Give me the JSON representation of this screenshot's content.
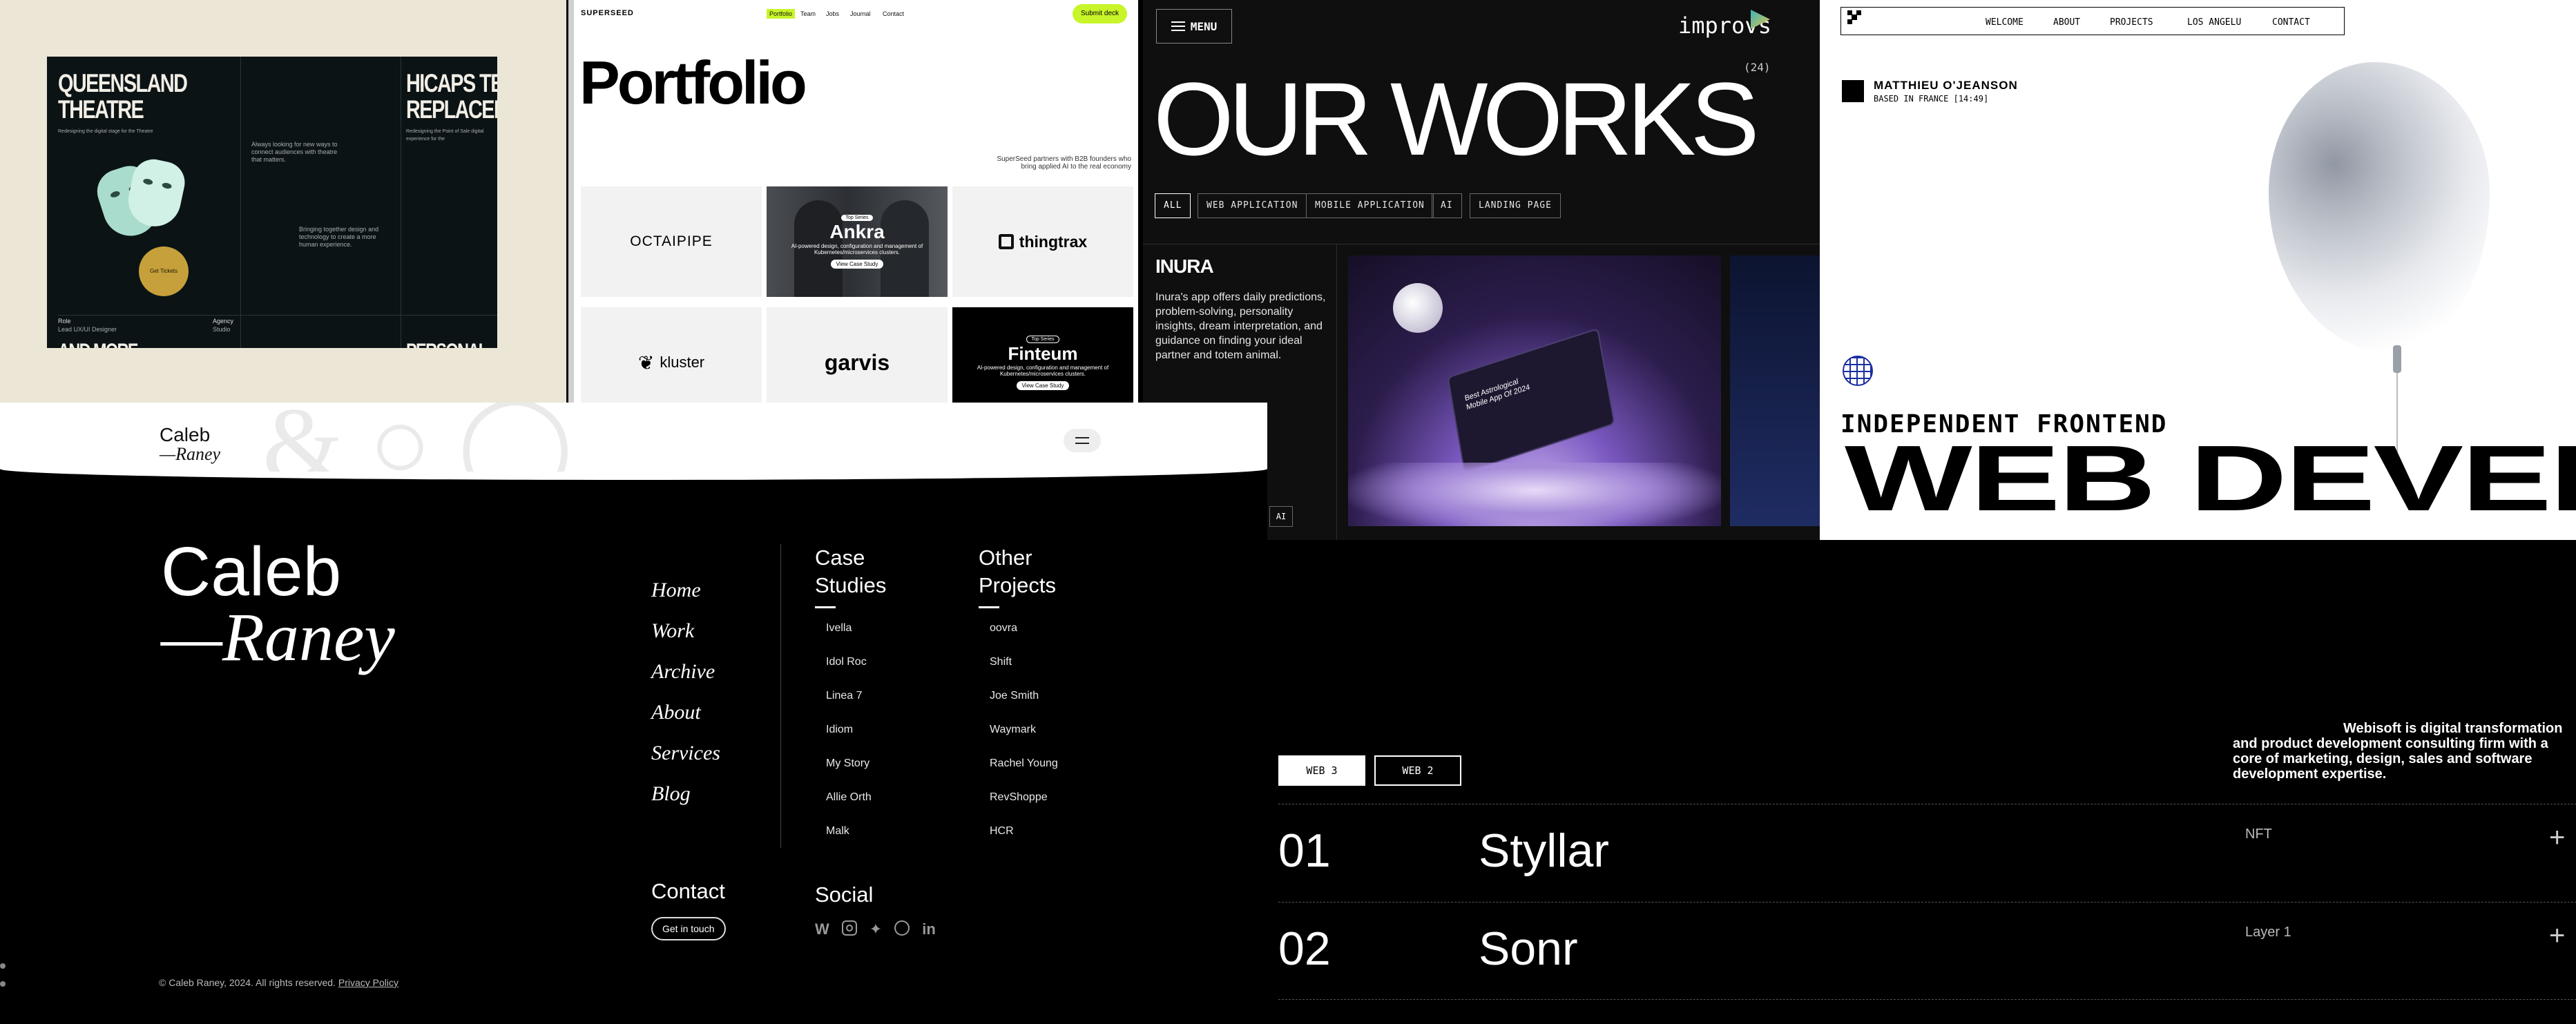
{
  "p1": {
    "title_left": [
      "QUEENSLAND",
      "THEATRE"
    ],
    "title_right": [
      "HICAPS TERM",
      "REPLACEMENT"
    ],
    "subtitle_left": "Redesigning the digital stage for the Theatre",
    "subtitle_right": "Redesigning the Point of Sale digital experience for the",
    "body_text_1": "Always looking for new ways to connect audiences with theatre that matters.",
    "body_text_2": "Bringing together design and technology to create a more human experience.",
    "circle_label": "Get Tickets",
    "footer_role": "Role",
    "footer_agency": "Agency",
    "footer_role_value": "Lead UX/UI Designer",
    "footer_agency_value": "Studio",
    "bottom_left": "AND MORE",
    "bottom_right": "PERSONAL"
  },
  "p2": {
    "logo": "SUPERSEED",
    "nav": [
      "Portfolio",
      "Team",
      "Jobs",
      "Journal",
      "Contact"
    ],
    "cta": "Submit deck",
    "heading": "Portfolio",
    "tagline": "SuperSeed partners with B2B founders who bring applied AI to the real economy",
    "tiles": {
      "octaipipe": "OCTAIPIPE",
      "ankra_tag": "Top Series",
      "ankra": "Ankra",
      "ankra_desc": "AI-powered design, configuration and management of Kubernetes/microservices clusters.",
      "ankra_cta": "View Case Study",
      "thingtrax": "thingtrax",
      "kluster": "kluster",
      "garvis": "garvis",
      "finteum_tag": "Top Series",
      "finteum": "Finteum",
      "finteum_desc": "AI-powered design, configuration and management of Kubernetes/microservices clusters.",
      "finteum_cta": "View Case Study"
    }
  },
  "p3": {
    "menu": "MENU",
    "logo": "improvs",
    "heading": "OUR WORKS",
    "count": "(24)",
    "tags": [
      "ALL",
      "WEB APPLICATION",
      "MOBILE APPLICATION",
      "AI",
      "LANDING PAGE"
    ],
    "project_title": "INURA",
    "project_desc": "Inura's app offers daily predictions, problem-solving, personality insights, dream interpretation, and guidance on finding your ideal partner and totem animal.",
    "project_tag": "AI",
    "screen_title": "Best Astrological Mobile App Of 2024"
  },
  "p4": {
    "nav": [
      "WELCOME",
      "ABOUT",
      "PROJECTS",
      "LOS ANGELU",
      "CONTACT"
    ],
    "name": "MATTHIEU O'JEANSON",
    "location": "BASED IN FRANCE [14:49]",
    "subtitle": "INDEPENDENT FRONTEND",
    "headline": "WEB DEVEL"
  },
  "p5": {
    "logo_top": "Caleb",
    "logo_bottom": "—Raney",
    "big_first": "Caleb",
    "big_last": "—Raney",
    "nav": [
      "Home",
      "Work",
      "Archive",
      "About",
      "Services",
      "Blog"
    ],
    "case_studies_title_1": "Case",
    "case_studies_title_2": "Studies",
    "case_studies": [
      "Ivella",
      "Idol Roc",
      "Linea 7",
      "Idiom",
      "My Story",
      "Allie Orth",
      "Malk"
    ],
    "other_title_1": "Other",
    "other_title_2": "Projects",
    "other_projects": [
      "oovra",
      "Shift",
      "Joe Smith",
      "Waymark",
      "Rachel Young",
      "RevShoppe",
      "HCR"
    ],
    "contact_title": "Contact",
    "contact_button": "Get in touch",
    "social_title": "Social",
    "social_icons": [
      "webflow-icon",
      "instagram-icon",
      "twitter-icon",
      "dribbble-icon",
      "linkedin-icon"
    ],
    "copyright": "© Caleb Raney, 2024. All rights reserved.",
    "privacy": "Privacy Policy"
  },
  "p6": {
    "intro": "Webisoft is digital transformation and product development consulting firm with a core of marketing, design, sales and software development expertise.",
    "tabs": [
      "WEB 3",
      "WEB 2"
    ],
    "rows": [
      {
        "num": "01",
        "name": "Styllar",
        "tag": "NFT"
      },
      {
        "num": "02",
        "name": "Sonr",
        "tag": "Layer 1"
      }
    ]
  }
}
